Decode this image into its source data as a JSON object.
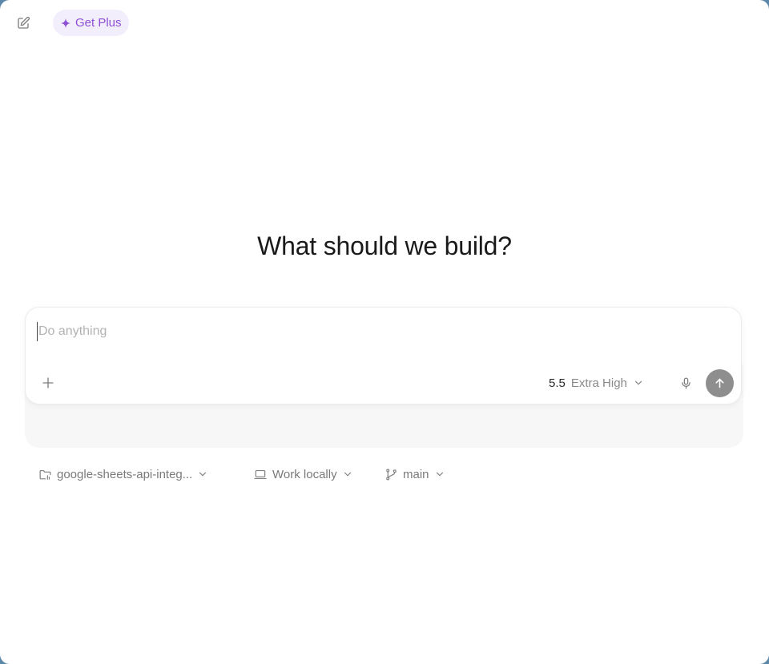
{
  "top_bar": {
    "new_chat_icon": "edit-icon",
    "get_plus": {
      "icon": "sparkle-icon",
      "label": "Get Plus",
      "accent_color": "#8c4fd6",
      "background": "#f3eefc"
    }
  },
  "headline": "What should we build?",
  "composer": {
    "placeholder": "Do anything",
    "value": "",
    "add_icon": "plus-icon",
    "model": {
      "version": "5.5",
      "effort": "Extra High",
      "icon": "chevron-down-icon"
    },
    "mic_icon": "microphone-icon",
    "send_icon": "arrow-up-icon"
  },
  "context": {
    "project": {
      "icon": "folder-icon",
      "label": "google-sheets-api-integ..."
    },
    "environment": {
      "icon": "laptop-icon",
      "label": "Work locally"
    },
    "branch": {
      "icon": "git-branch-icon",
      "label": "main"
    }
  }
}
